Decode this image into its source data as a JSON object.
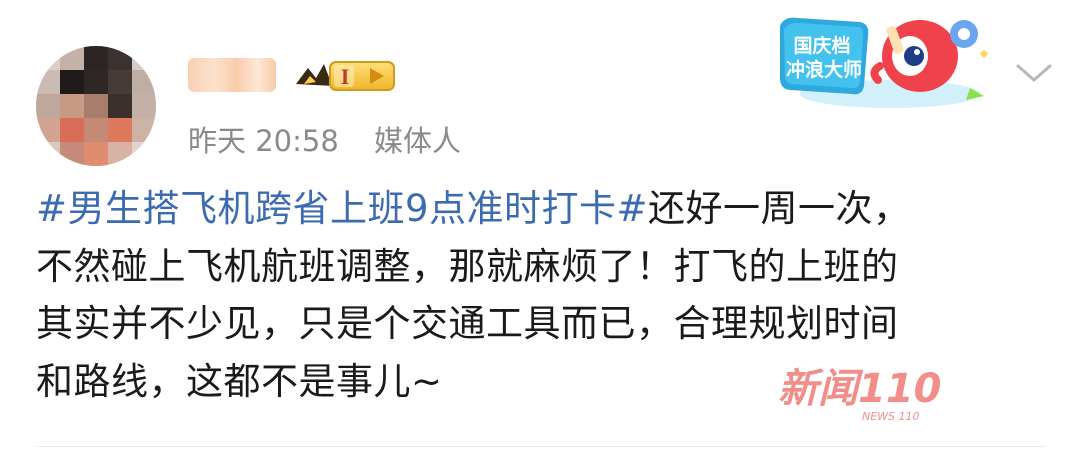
{
  "user": {
    "badge_level": "I",
    "time": "昨天 20:58",
    "source": "媒体人"
  },
  "promo": {
    "line1": "国庆档",
    "line2": "冲浪大师"
  },
  "post": {
    "topic": "#男生搭飞机跨省上班9点准时打卡#",
    "line1_rest": "还好一周一次，",
    "line2": "不然碰上飞机航班调整，那就麻烦了！打飞的上班的",
    "line3": "其实并不少见，只是个交通工具而已，合理规划时间",
    "line4": "和路线，这都不是事儿~"
  },
  "watermark": {
    "text": "新闻110",
    "sub": "NEWS 110"
  },
  "icons": {
    "chevron": "chevron-down-icon",
    "badge": "vip-badge-icon",
    "promo": "promo-mascot-icon"
  },
  "colors": {
    "topic": "#3c6bb1",
    "meta": "#8a8a8a",
    "badge_gold": "#f4c542",
    "mascot_red": "#f0424b",
    "watermark_red": "#e8322b"
  }
}
